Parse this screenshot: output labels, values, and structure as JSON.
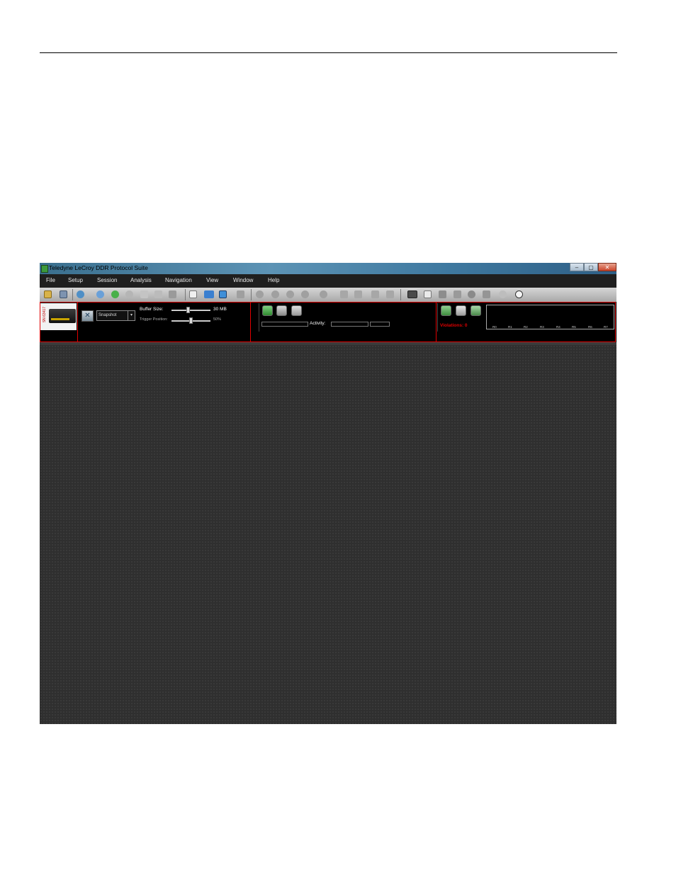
{
  "window": {
    "title": "Teledyne LeCroy DDR Protocol Suite",
    "controls": [
      "–",
      "▢",
      "✕"
    ]
  },
  "menu": [
    "File",
    "Setup",
    "Session",
    "Analysis",
    "Navigation",
    "View",
    "Window",
    "Help"
  ],
  "device": {
    "serial": "SN 63417"
  },
  "capture": {
    "mode": "Snapshot",
    "buffer_label": "Buffer Size:",
    "buffer_value": "30  MB",
    "buffer_fraction": 0.42,
    "trigger_label": "Trigger Position:",
    "trigger_value": "50%",
    "trigger_fraction": 0.5
  },
  "recording": {
    "activity_label": "Activity:"
  },
  "verification": {
    "violations_label": "Violations: 0",
    "ranks": [
      "R0",
      "R1",
      "R2",
      "R3",
      "R4",
      "R5",
      "R6",
      "R7"
    ]
  },
  "colors": {
    "highlight": "#e00000",
    "menubar": "#1f1f1f",
    "workspace": "#2f2f2f"
  }
}
